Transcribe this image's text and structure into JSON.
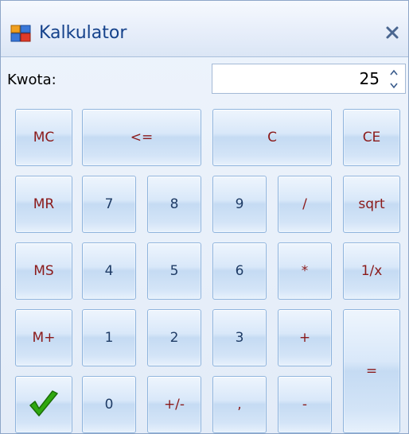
{
  "window": {
    "title": "Kalkulator",
    "accent_color": "#15428b",
    "icon": "calculator-app-icon",
    "close_icon": "close-icon"
  },
  "kwota": {
    "label": "Kwota:",
    "value": "25"
  },
  "buttons": {
    "mc": "MC",
    "backspace": "<=",
    "clear": "C",
    "clear_entry": "CE",
    "mr": "MR",
    "d7": "7",
    "d8": "8",
    "d9": "9",
    "divide": "/",
    "sqrt": "sqrt",
    "ms": "MS",
    "d4": "4",
    "d5": "5",
    "d6": "6",
    "multiply": "*",
    "reciprocal": "1/x",
    "mplus": "M+",
    "d1": "1",
    "d2": "2",
    "d3": "3",
    "plus": "+",
    "equals": "=",
    "ok_icon": "checkmark-icon",
    "d0": "0",
    "negate": "+/-",
    "comma": ",",
    "minus": "-"
  },
  "colors": {
    "button_text": "#8b1a1a",
    "digit_text": "#1f3c66",
    "check_green": "#2fa80f"
  }
}
